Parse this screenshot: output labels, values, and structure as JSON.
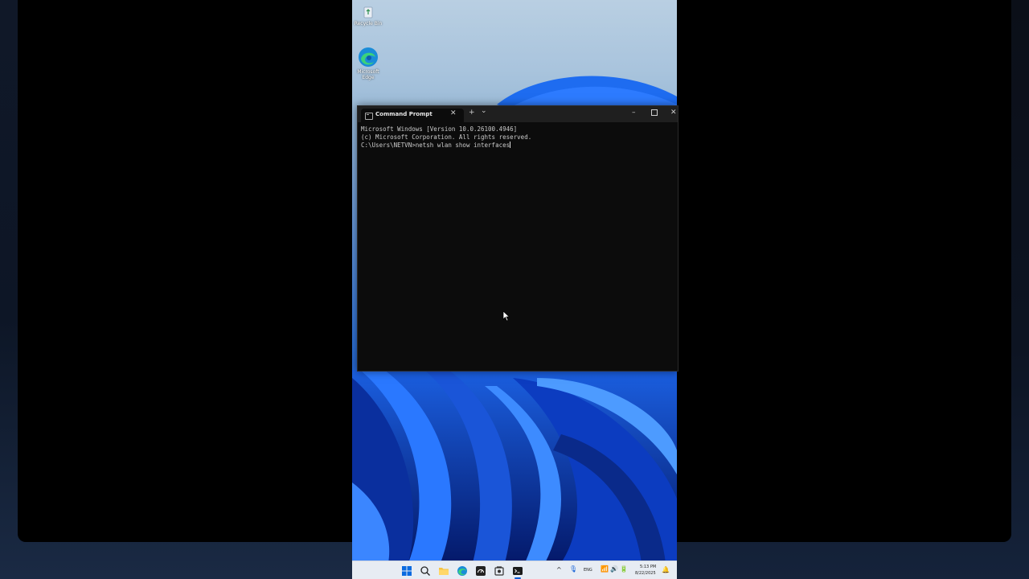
{
  "desktop": {
    "icons": [
      {
        "label": "Recycle Bin"
      },
      {
        "label": "Microsoft Edge"
      }
    ]
  },
  "terminal": {
    "tab_title": "Command Prompt",
    "new_tab": "+",
    "dropdown": "⌄",
    "lines": [
      "Microsoft Windows [Version 10.0.26100.4946]",
      "(c) Microsoft Corporation. All rights reserved.",
      "",
      "C:\\Users\\NETVN>netsh wlan show interfaces"
    ]
  },
  "taskbar": {
    "language": "ENG",
    "time": "5:13 PM",
    "date": "8/22/2025"
  },
  "colors": {
    "accent": "#0a5bd6",
    "terminal_bg": "#0c0c0c",
    "titlebar_bg": "#1f1f1f"
  }
}
